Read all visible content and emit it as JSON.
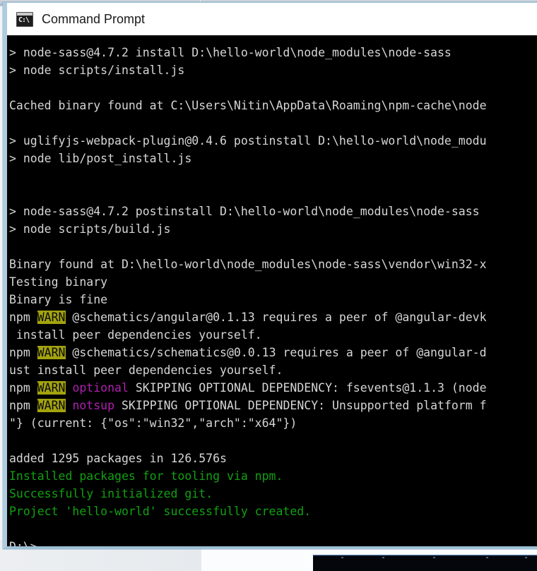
{
  "window": {
    "title": "Command Prompt",
    "icon": "command-prompt-icon",
    "icon_glyph": "C:\\",
    "colors": {
      "console_background": "#000000",
      "default_text": "#d6d6d6",
      "warn_badge_background": "#a3a30f",
      "warn_badge_text": "#0a0a0a",
      "magenta_text": "#b020b0",
      "green_text": "#12a012",
      "title_bar_background": "#ffffff",
      "window_border": "#aeccde"
    }
  },
  "console": {
    "lines": [
      {
        "id": 0,
        "segments": [
          {
            "text": "> node-sass@4.7.2 install D:\\hello-world\\node_modules\\node-sass",
            "style": "default"
          }
        ]
      },
      {
        "id": 1,
        "segments": [
          {
            "text": "> node scripts/install.js",
            "style": "default"
          }
        ]
      },
      {
        "id": 2,
        "segments": [
          {
            "text": "",
            "style": "default"
          }
        ]
      },
      {
        "id": 3,
        "segments": [
          {
            "text": "Cached binary found at C:\\Users\\Nitin\\AppData\\Roaming\\npm-cache\\node",
            "style": "default"
          }
        ]
      },
      {
        "id": 4,
        "segments": [
          {
            "text": "",
            "style": "default"
          }
        ]
      },
      {
        "id": 5,
        "segments": [
          {
            "text": "> uglifyjs-webpack-plugin@0.4.6 postinstall D:\\hello-world\\node_modu",
            "style": "default"
          }
        ]
      },
      {
        "id": 6,
        "segments": [
          {
            "text": "> node lib/post_install.js",
            "style": "default"
          }
        ]
      },
      {
        "id": 7,
        "segments": [
          {
            "text": "",
            "style": "default"
          }
        ]
      },
      {
        "id": 8,
        "segments": [
          {
            "text": "",
            "style": "default"
          }
        ]
      },
      {
        "id": 9,
        "segments": [
          {
            "text": "> node-sass@4.7.2 postinstall D:\\hello-world\\node_modules\\node-sass",
            "style": "default"
          }
        ]
      },
      {
        "id": 10,
        "segments": [
          {
            "text": "> node scripts/build.js",
            "style": "default"
          }
        ]
      },
      {
        "id": 11,
        "segments": [
          {
            "text": "",
            "style": "default"
          }
        ]
      },
      {
        "id": 12,
        "segments": [
          {
            "text": "Binary found at D:\\hello-world\\node_modules\\node-sass\\vendor\\win32-x",
            "style": "default"
          }
        ]
      },
      {
        "id": 13,
        "segments": [
          {
            "text": "Testing binary",
            "style": "default"
          }
        ]
      },
      {
        "id": 14,
        "segments": [
          {
            "text": "Binary is fine",
            "style": "default"
          }
        ]
      },
      {
        "id": 15,
        "segments": [
          {
            "text": "npm ",
            "style": "default"
          },
          {
            "text": "WARN",
            "style": "warn"
          },
          {
            "text": " @schematics/angular@0.1.13 requires a peer of @angular-devk",
            "style": "default"
          }
        ]
      },
      {
        "id": 16,
        "segments": [
          {
            "text": " install peer dependencies yourself.",
            "style": "default"
          }
        ]
      },
      {
        "id": 17,
        "segments": [
          {
            "text": "npm ",
            "style": "default"
          },
          {
            "text": "WARN",
            "style": "warn"
          },
          {
            "text": " @schematics/schematics@0.0.13 requires a peer of @angular-d",
            "style": "default"
          }
        ]
      },
      {
        "id": 18,
        "segments": [
          {
            "text": "ust install peer dependencies yourself.",
            "style": "default"
          }
        ]
      },
      {
        "id": 19,
        "segments": [
          {
            "text": "npm ",
            "style": "default"
          },
          {
            "text": "WARN",
            "style": "warn"
          },
          {
            "text": " ",
            "style": "default"
          },
          {
            "text": "optional",
            "style": "magenta"
          },
          {
            "text": " SKIPPING OPTIONAL DEPENDENCY: fsevents@1.1.3 (node",
            "style": "default"
          }
        ]
      },
      {
        "id": 20,
        "segments": [
          {
            "text": "npm ",
            "style": "default"
          },
          {
            "text": "WARN",
            "style": "warn"
          },
          {
            "text": " ",
            "style": "default"
          },
          {
            "text": "notsup",
            "style": "magenta"
          },
          {
            "text": " SKIPPING OPTIONAL DEPENDENCY: Unsupported platform f",
            "style": "default"
          }
        ]
      },
      {
        "id": 21,
        "segments": [
          {
            "text": "\"} (current: {\"os\":\"win32\",\"arch\":\"x64\"})",
            "style": "default"
          }
        ]
      },
      {
        "id": 22,
        "segments": [
          {
            "text": "",
            "style": "default"
          }
        ]
      },
      {
        "id": 23,
        "segments": [
          {
            "text": "added 1295 packages in 126.576s",
            "style": "default"
          }
        ]
      },
      {
        "id": 24,
        "segments": [
          {
            "text": "Installed packages for tooling via npm.",
            "style": "green"
          }
        ]
      },
      {
        "id": 25,
        "segments": [
          {
            "text": "Successfully initialized git.",
            "style": "green"
          }
        ]
      },
      {
        "id": 26,
        "segments": [
          {
            "text": "Project 'hello-world' successfully created.",
            "style": "green"
          }
        ]
      },
      {
        "id": 27,
        "segments": [
          {
            "text": "",
            "style": "default"
          }
        ]
      },
      {
        "id": 28,
        "segments": [
          {
            "text": "D:\\>",
            "style": "default"
          }
        ]
      }
    ]
  }
}
